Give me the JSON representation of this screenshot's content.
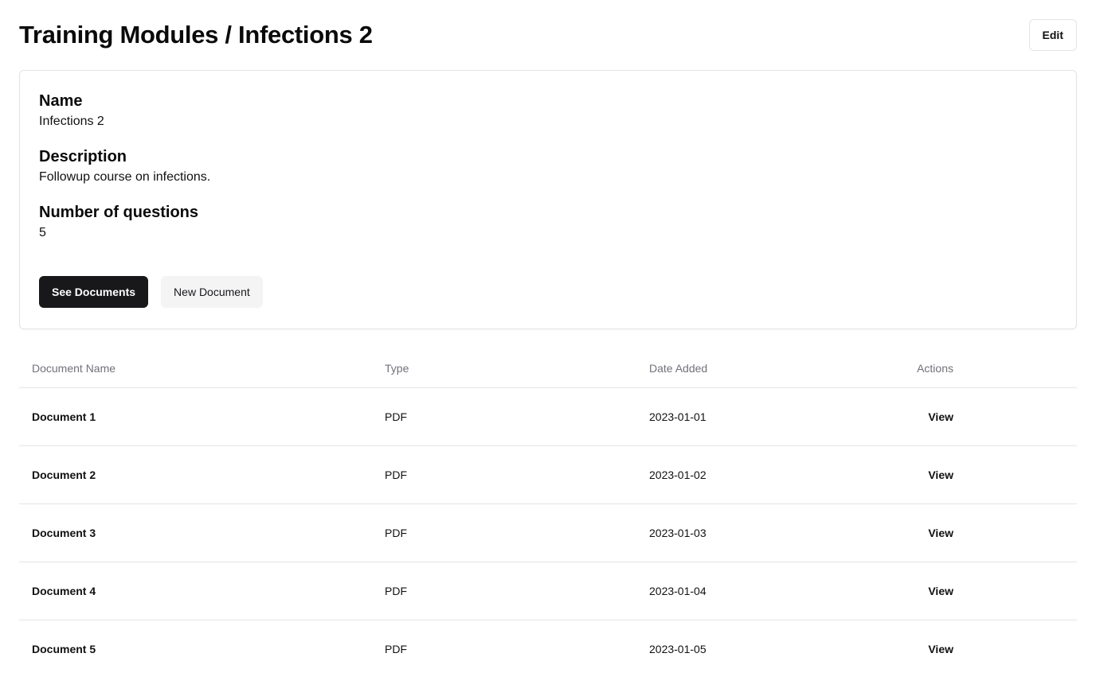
{
  "header": {
    "title": "Training Modules / Infections 2",
    "edit_label": "Edit"
  },
  "details": {
    "name_label": "Name",
    "name_value": "Infections 2",
    "description_label": "Description",
    "description_value": "Followup course on infections.",
    "questions_label": "Number of questions",
    "questions_value": "5"
  },
  "actions": {
    "see_documents_label": "See Documents",
    "new_document_label": "New Document"
  },
  "table": {
    "columns": [
      "Document Name",
      "Type",
      "Date Added",
      "Actions"
    ],
    "rows": [
      {
        "name": "Document 1",
        "type": "PDF",
        "date": "2023-01-01",
        "action": "View"
      },
      {
        "name": "Document 2",
        "type": "PDF",
        "date": "2023-01-02",
        "action": "View"
      },
      {
        "name": "Document 3",
        "type": "PDF",
        "date": "2023-01-03",
        "action": "View"
      },
      {
        "name": "Document 4",
        "type": "PDF",
        "date": "2023-01-04",
        "action": "View"
      },
      {
        "name": "Document 5",
        "type": "PDF",
        "date": "2023-01-05",
        "action": "View"
      }
    ]
  },
  "colors": {
    "primary_button": "#18181b",
    "secondary_button": "#f4f4f5",
    "border": "#e4e4e7",
    "muted_text": "#71717a"
  }
}
